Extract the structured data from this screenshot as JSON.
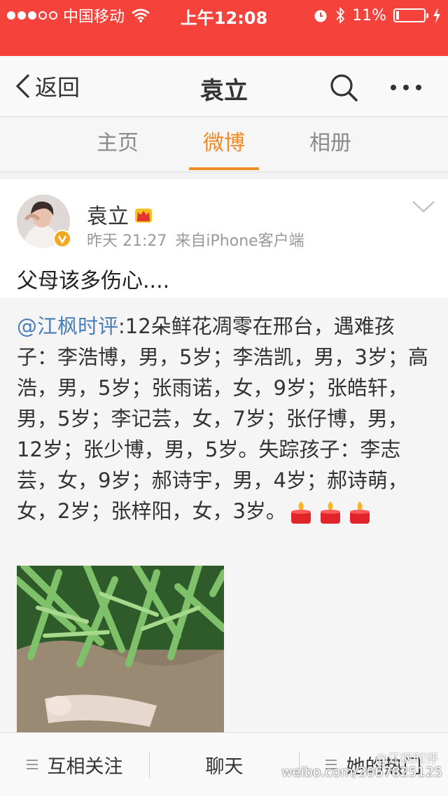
{
  "status_bar": {
    "carrier": "中国移动",
    "time": "上午12:08",
    "battery": "11%",
    "battery_level": 0.11
  },
  "nav": {
    "back_label": "返回",
    "title": "袁立"
  },
  "tabs": [
    {
      "label": "主页",
      "active": false
    },
    {
      "label": "微博",
      "active": true
    },
    {
      "label": "相册",
      "active": false
    }
  ],
  "post": {
    "author": "袁立",
    "time": "昨天 21:27",
    "source": "来自iPhone客户端",
    "text": "父母该多伤心....",
    "repost": {
      "mention": "@江枫时评",
      "text": ":12朵鲜花凋零在邢台，遇难孩子：李浩博，男，5岁；李浩凯，男，3岁；高浩，男，5岁；张雨诺，女，9岁；张皓轩，男，5岁；李记芸，女，7岁；张仔博，男，12岁；张少博，男，5岁。失踪孩子：李志芸，女，9岁；郝诗宇，男，4岁；郝诗萌，女，2岁；张梓阳，女，3岁。"
    }
  },
  "toolbar": {
    "follow_label": "互相关注",
    "chat_label": "聊天",
    "hot_label": "她的热门"
  },
  "watermark": {
    "logo_text": "@江枫时评",
    "url": "weibo.com/2067825125"
  },
  "colors": {
    "status_bar": "#f5423b",
    "accent": "#f08a24",
    "link": "#4a7fb5"
  }
}
